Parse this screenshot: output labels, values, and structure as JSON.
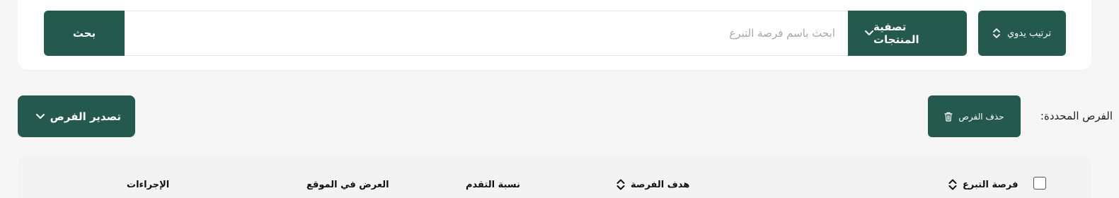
{
  "search": {
    "button_label": "بحث",
    "placeholder": "ابحث باسم فرصة التبرع",
    "filter_label": "تصفية المنتجات",
    "sort_label": "ترتيب يدوي"
  },
  "actions": {
    "export_label": "تصدير الفرص",
    "selected_label": "الفرص المحددة:",
    "delete_label": "حذف الفرص"
  },
  "table": {
    "columns": {
      "opportunity": "فرصة التبرع",
      "goal": "هدف الفرصة",
      "progress": "نسبة التقدم",
      "display": "العرض في الموقع",
      "actions": "الإجراءات"
    }
  },
  "colors": {
    "primary": "#245a4e",
    "background": "#f6f6f6"
  },
  "icons": {
    "sort": "sort-updown-icon",
    "chevron": "chevron-down-icon",
    "delete": "trash-icon"
  }
}
